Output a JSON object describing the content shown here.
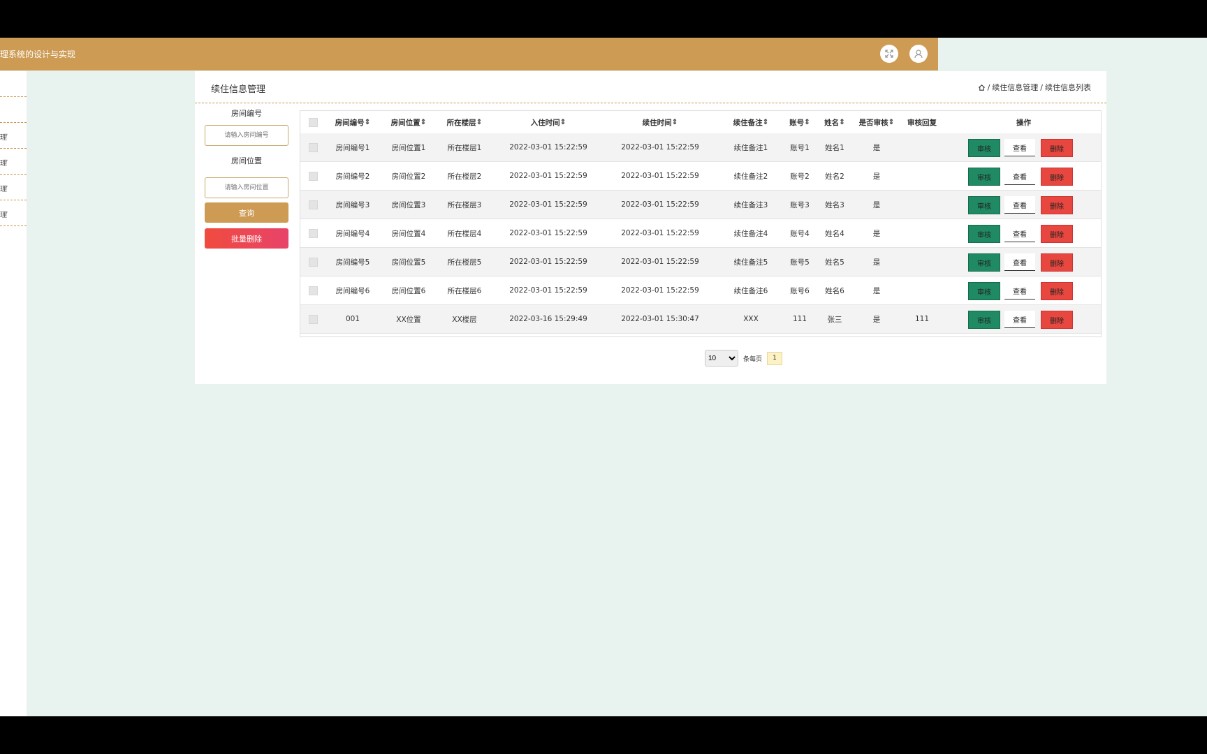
{
  "app": {
    "title": "理系统的设计与实现"
  },
  "sidebar": {
    "items": [
      "",
      "",
      "理",
      "理",
      "理",
      "理"
    ]
  },
  "panel": {
    "title": "续住信息管理",
    "breadcrumb": [
      "续住信息管理",
      "续住信息列表"
    ],
    "breadcrumb_sep": "/"
  },
  "search": {
    "room_no_label": "房间编号",
    "room_no_placeholder": "请输入房间编号",
    "room_loc_label": "房间位置",
    "room_loc_placeholder": "请输入房间位置",
    "query_label": "查询",
    "batch_delete_label": "批量删除"
  },
  "table": {
    "headers": [
      "房间编号",
      "房间位置",
      "所在楼层",
      "入住时间",
      "续住时间",
      "续住备注",
      "账号",
      "姓名",
      "是否审核",
      "审核回复",
      "操作"
    ],
    "rows": [
      [
        "房间编号1",
        "房间位置1",
        "所在楼层1",
        "2022-03-01 15:22:59",
        "2022-03-01 15:22:59",
        "续住备注1",
        "账号1",
        "姓名1",
        "是",
        ""
      ],
      [
        "房间编号2",
        "房间位置2",
        "所在楼层2",
        "2022-03-01 15:22:59",
        "2022-03-01 15:22:59",
        "续住备注2",
        "账号2",
        "姓名2",
        "是",
        ""
      ],
      [
        "房间编号3",
        "房间位置3",
        "所在楼层3",
        "2022-03-01 15:22:59",
        "2022-03-01 15:22:59",
        "续住备注3",
        "账号3",
        "姓名3",
        "是",
        ""
      ],
      [
        "房间编号4",
        "房间位置4",
        "所在楼层4",
        "2022-03-01 15:22:59",
        "2022-03-01 15:22:59",
        "续住备注4",
        "账号4",
        "姓名4",
        "是",
        ""
      ],
      [
        "房间编号5",
        "房间位置5",
        "所在楼层5",
        "2022-03-01 15:22:59",
        "2022-03-01 15:22:59",
        "续住备注5",
        "账号5",
        "姓名5",
        "是",
        ""
      ],
      [
        "房间编号6",
        "房间位置6",
        "所在楼层6",
        "2022-03-01 15:22:59",
        "2022-03-01 15:22:59",
        "续住备注6",
        "账号6",
        "姓名6",
        "是",
        ""
      ],
      [
        "001",
        "XX位置",
        "XX楼层",
        "2022-03-16 15:29:49",
        "2022-03-01 15:30:47",
        "XXX",
        "111",
        "张三",
        "是",
        "111"
      ]
    ],
    "actions": {
      "audit": "审核",
      "view": "查看",
      "delete": "删除"
    }
  },
  "pager": {
    "page_size": "10",
    "per_page_label": "条每页",
    "current_page": "1"
  },
  "colors": {
    "header": "#cd9b53",
    "background": "#e8f2ee",
    "audit": "#1f8a63",
    "delete": "#e8473f"
  }
}
